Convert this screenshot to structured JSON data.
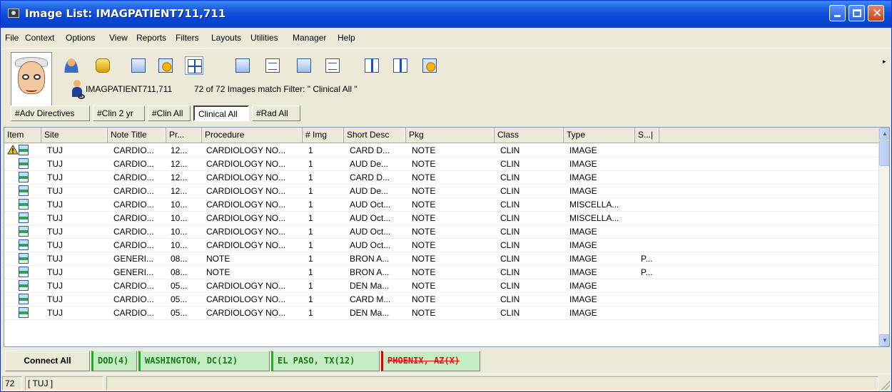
{
  "window": {
    "title": "Image List: IMAGPATIENT711,711"
  },
  "menu": [
    "File",
    "Context",
    "Options",
    "View",
    "Reports",
    "Filters",
    "Layouts",
    "Utilities",
    "Manager",
    "Help"
  ],
  "toolbar": {
    "icons": [
      "patient-photo",
      "person-icon",
      "database-refresh-icon",
      "image-export-icon",
      "settings-window-icon",
      "grid-layout-icon",
      "image-icon",
      "document-icon",
      "image-search-icon",
      "document-search-icon",
      "column-split-icon",
      "column-split-alt-icon",
      "gear-settings-icon"
    ]
  },
  "patient": {
    "name": "IMAGPATIENT711,711",
    "filter_status": "72 of 72 Images match Filter: \" Clinical All \""
  },
  "filters": {
    "tabs": [
      {
        "label": "#Adv Directives",
        "active": false
      },
      {
        "label": "#Clin 2 yr",
        "active": false
      },
      {
        "label": "#Clin All",
        "active": false
      },
      {
        "label": "Clinical All",
        "active": true
      },
      {
        "label": "#Rad All",
        "active": false
      }
    ]
  },
  "grid": {
    "columns": [
      "Item",
      "Site",
      "Note Title",
      "Pr...",
      "Procedure",
      "# Img",
      "Short Desc",
      "Pkg",
      "Class",
      "Type",
      "S...|"
    ],
    "rows": [
      {
        "site": "TUJ",
        "note": "CARDIO...",
        "pr": "12...",
        "proc": "CARDIOLOGY NO...",
        "img": "1",
        "desc": "CARD D...",
        "pkg": "NOTE",
        "cls": "CLIN",
        "type": "IMAGE",
        "s": "",
        "warn": true
      },
      {
        "site": "TUJ",
        "note": "CARDIO...",
        "pr": "12...",
        "proc": "CARDIOLOGY NO...",
        "img": "1",
        "desc": "AUD De...",
        "pkg": "NOTE",
        "cls": "CLIN",
        "type": "IMAGE",
        "s": "",
        "warn": false
      },
      {
        "site": "TUJ",
        "note": "CARDIO...",
        "pr": "12...",
        "proc": "CARDIOLOGY NO...",
        "img": "1",
        "desc": "CARD D...",
        "pkg": "NOTE",
        "cls": "CLIN",
        "type": "IMAGE",
        "s": "",
        "warn": false
      },
      {
        "site": "TUJ",
        "note": "CARDIO...",
        "pr": "12...",
        "proc": "CARDIOLOGY NO...",
        "img": "1",
        "desc": "AUD De...",
        "pkg": "NOTE",
        "cls": "CLIN",
        "type": "IMAGE",
        "s": "",
        "warn": false
      },
      {
        "site": "TUJ",
        "note": "CARDIO...",
        "pr": "10...",
        "proc": "CARDIOLOGY NO...",
        "img": "1",
        "desc": "AUD Oct...",
        "pkg": "NOTE",
        "cls": "CLIN",
        "type": "MISCELLA...",
        "s": "",
        "warn": false
      },
      {
        "site": "TUJ",
        "note": "CARDIO...",
        "pr": "10...",
        "proc": "CARDIOLOGY NO...",
        "img": "1",
        "desc": "AUD Oct...",
        "pkg": "NOTE",
        "cls": "CLIN",
        "type": "MISCELLA...",
        "s": "",
        "warn": false
      },
      {
        "site": "TUJ",
        "note": "CARDIO...",
        "pr": "10...",
        "proc": "CARDIOLOGY NO...",
        "img": "1",
        "desc": "AUD Oct...",
        "pkg": "NOTE",
        "cls": "CLIN",
        "type": "IMAGE",
        "s": "",
        "warn": false
      },
      {
        "site": "TUJ",
        "note": "CARDIO...",
        "pr": "10...",
        "proc": "CARDIOLOGY NO...",
        "img": "1",
        "desc": "AUD Oct...",
        "pkg": "NOTE",
        "cls": "CLIN",
        "type": "IMAGE",
        "s": "",
        "warn": false
      },
      {
        "site": "TUJ",
        "note": "GENERI...",
        "pr": "08...",
        "proc": "NOTE",
        "img": "1",
        "desc": "BRON A...",
        "pkg": "NOTE",
        "cls": "CLIN",
        "type": "IMAGE",
        "s": "P...",
        "warn": false
      },
      {
        "site": "TUJ",
        "note": "GENERI...",
        "pr": "08...",
        "proc": "NOTE",
        "img": "1",
        "desc": "BRON A...",
        "pkg": "NOTE",
        "cls": "CLIN",
        "type": "IMAGE",
        "s": "P...",
        "warn": false
      },
      {
        "site": "TUJ",
        "note": "CARDIO...",
        "pr": "05...",
        "proc": "CARDIOLOGY NO...",
        "img": "1",
        "desc": "DEN Ma...",
        "pkg": "NOTE",
        "cls": "CLIN",
        "type": "IMAGE",
        "s": "",
        "warn": false
      },
      {
        "site": "TUJ",
        "note": "CARDIO...",
        "pr": "05...",
        "proc": "CARDIOLOGY NO...",
        "img": "1",
        "desc": "CARD M...",
        "pkg": "NOTE",
        "cls": "CLIN",
        "type": "IMAGE",
        "s": "",
        "warn": false
      },
      {
        "site": "TUJ",
        "note": "CARDIO...",
        "pr": "05...",
        "proc": "CARDIOLOGY NO...",
        "img": "1",
        "desc": "DEN Ma...",
        "pkg": "NOTE",
        "cls": "CLIN",
        "type": "IMAGE",
        "s": "",
        "warn": false
      }
    ]
  },
  "sites": {
    "connect_label": "Connect All",
    "items": [
      {
        "label": "DOD(4)",
        "status": "connected"
      },
      {
        "label": "WASHINGTON, DC(12)",
        "status": "connected"
      },
      {
        "label": "EL PASO, TX(12)",
        "status": "connected"
      },
      {
        "label": "PHOENIX, AZ(X)",
        "status": "disconnected"
      }
    ]
  },
  "status": {
    "count": "72",
    "site": "[ TUJ ]"
  },
  "colors": {
    "titlebar": "#0a46d8",
    "site_connected": "#157a15",
    "site_disconnected": "#e01010",
    "site_bg": "#c6ecc6"
  }
}
